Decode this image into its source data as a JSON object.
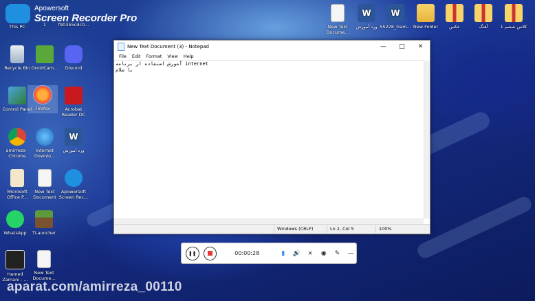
{
  "brand": {
    "line1": "Apowersoft",
    "line2": "Screen Recorder Pro"
  },
  "desktop_left": [
    {
      "name": "this-pc",
      "label": "This PC"
    },
    {
      "name": "one",
      "label": "1"
    },
    {
      "name": "file-hash",
      "label": "f90355cdc0..."
    },
    {
      "name": "recycle-bin",
      "label": "Recycle Bin"
    },
    {
      "name": "droidcam",
      "label": "DroidCam..."
    },
    {
      "name": "discord",
      "label": "Discord"
    },
    {
      "name": "control-panel",
      "label": "Control Panel"
    },
    {
      "name": "firefox",
      "label": "Firefox"
    },
    {
      "name": "acrobat",
      "label": "Acrobat Reader DC"
    },
    {
      "name": "chrome",
      "label": "amirreza - Chrome"
    },
    {
      "name": "internet-download",
      "label": "Internet Downlo..."
    },
    {
      "name": "word-doc",
      "label": "ورد اموزش"
    },
    {
      "name": "office",
      "label": "Microsoft Office P..."
    },
    {
      "name": "new-text-1",
      "label": "New Text Document"
    },
    {
      "name": "apowersoft",
      "label": "Apowersoft Screen Rec..."
    },
    {
      "name": "whatsapp",
      "label": "WhatsApp"
    },
    {
      "name": "tlauncher",
      "label": "TLauncher"
    },
    {
      "name": "hamed",
      "label": "Hamed Zamani - ..."
    },
    {
      "name": "new-text-2",
      "label": "New Text Docume..."
    }
  ],
  "desktop_top": [
    {
      "name": "new-text-top",
      "label": "New Text Docume..."
    },
    {
      "name": "word-persian",
      "label": "ورد آموزش"
    },
    {
      "name": "word-game",
      "label": "55228_Gam..."
    },
    {
      "name": "new-folder",
      "label": "New Folder"
    },
    {
      "name": "aks",
      "label": "عکس"
    },
    {
      "name": "ahang",
      "label": "آهنگ"
    },
    {
      "name": "class",
      "label": "کلاس ششم 1"
    }
  ],
  "notepad": {
    "title": "New Text Document (3) - Notepad",
    "menu": [
      "File",
      "Edit",
      "Format",
      "View",
      "Help"
    ],
    "lines": [
      "آموزش استفاده از برنامه internet",
      "با سلام"
    ],
    "status": {
      "encoding": "Windows (CRLF)",
      "position": "Ln 2, Col 5",
      "zoom": "100%"
    }
  },
  "recorder": {
    "time": "00:00:28"
  },
  "watermark": "aparat.com/amirreza_00110"
}
